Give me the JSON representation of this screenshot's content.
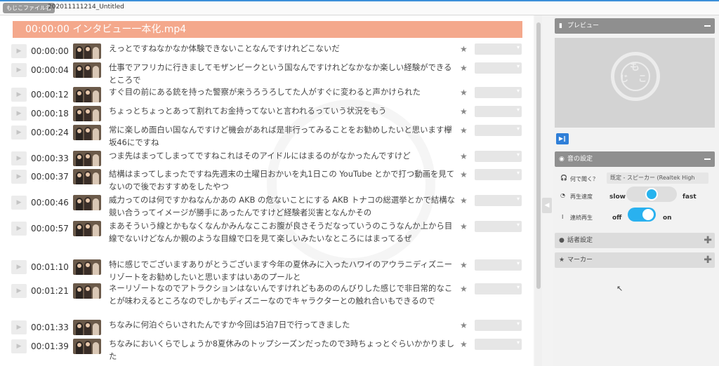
{
  "topbar": {
    "app_badge": "もじこファイル名",
    "file_name": "202011111214_Untitled"
  },
  "transcript": {
    "file_header": "00:00:00  インタビュー一本化.mp4",
    "rows": [
      {
        "time": "00:00:00",
        "text": "えっとですねなかなか体験できないことなんですけれどこないだ"
      },
      {
        "time": "00:00:04",
        "text": "仕事でアフリカに行きましてモザンビークという国なんですけれどなかなか楽しい経験ができるところで"
      },
      {
        "time": "00:00:12",
        "text": "すぐ目の前にある銃を持った警察が来うろうろしてた人がすぐに変わると声かけられた"
      },
      {
        "time": "00:00:18",
        "text": "ちょっとちょっとあって割れてお金持ってないと言われるっていう状況をもう"
      },
      {
        "time": "00:00:24",
        "text": "常に楽しめ面白い国なんですけど機会があれば是非行ってみることをお勧めしたいと思います欅坂46にですね"
      },
      {
        "time": "00:00:33",
        "text": "つま先はまってしまってですねこれはそのアイドルにはまるのがなかったんですけど"
      },
      {
        "time": "00:00:37",
        "text": "結構はまってしまったですね先週末の土曜日おかいを丸1日この YouTube とかで打つ動画を見てないので後でおすすめをしたやつ"
      },
      {
        "time": "00:00:46",
        "text": "威力ってのは何ですかねなんかあの AKB の危ないことにする AKB トナコの総選挙とかで結構な競い合うってイメージが勝手にあったんですけど経験者災害となんかその"
      },
      {
        "time": "00:00:57",
        "text": "まあそういう線とかもなくなんかみんなここお腹が良さそうだなっていうのこうなんか上から目線でないけどなんか親のような目線で口を見て楽しいみたいなところにはまってるぜ"
      },
      {
        "time": "00:01:10",
        "text": "特に感じでございますありがとうございます今年の夏休みに入ったハワイのアウラニディズニーリゾートをお勧めしたいと思いますはいあのプールと"
      },
      {
        "time": "00:01:21",
        "text": "ネーリゾートなのでアトラクションはないんですけれどもあののんびりした感じで非日常的なことが味わえるところなのでしかもディズニーなのでキャラクターとの触れ合いもできるので"
      },
      {
        "time": "00:01:33",
        "text": "ちなみに何泊ぐらいされたんですか今回は5泊7日で行ってきました"
      },
      {
        "time": "00:01:39",
        "text": "ちなみにおいくらでしょうか8夏休みのトップシーズンだったので3時ちょっとぐらいかかりました"
      }
    ]
  },
  "right_panel": {
    "preview_title": "プレビュー",
    "play_pause_icon": "play-pause-icon",
    "sound_settings_title": "音の設定",
    "listen_label": "何で聞く？",
    "device_value": "既定 - スピーカー (Realtek High",
    "speed_label": "再生速度",
    "speed_slow": "slow",
    "speed_fast": "fast",
    "speed_value": 0.5,
    "skip_label": "連続再生",
    "skip_off": "off",
    "skip_on": "on",
    "skip_enabled": true,
    "speaker_settings_title": "話者設定",
    "marker_title": "マーカー"
  },
  "colors": {
    "accent": "#3b8fd9",
    "header_salmon": "#f4a88c",
    "toggle_blue": "#29b1ef",
    "panel_header_gray": "#8f8f8f"
  }
}
